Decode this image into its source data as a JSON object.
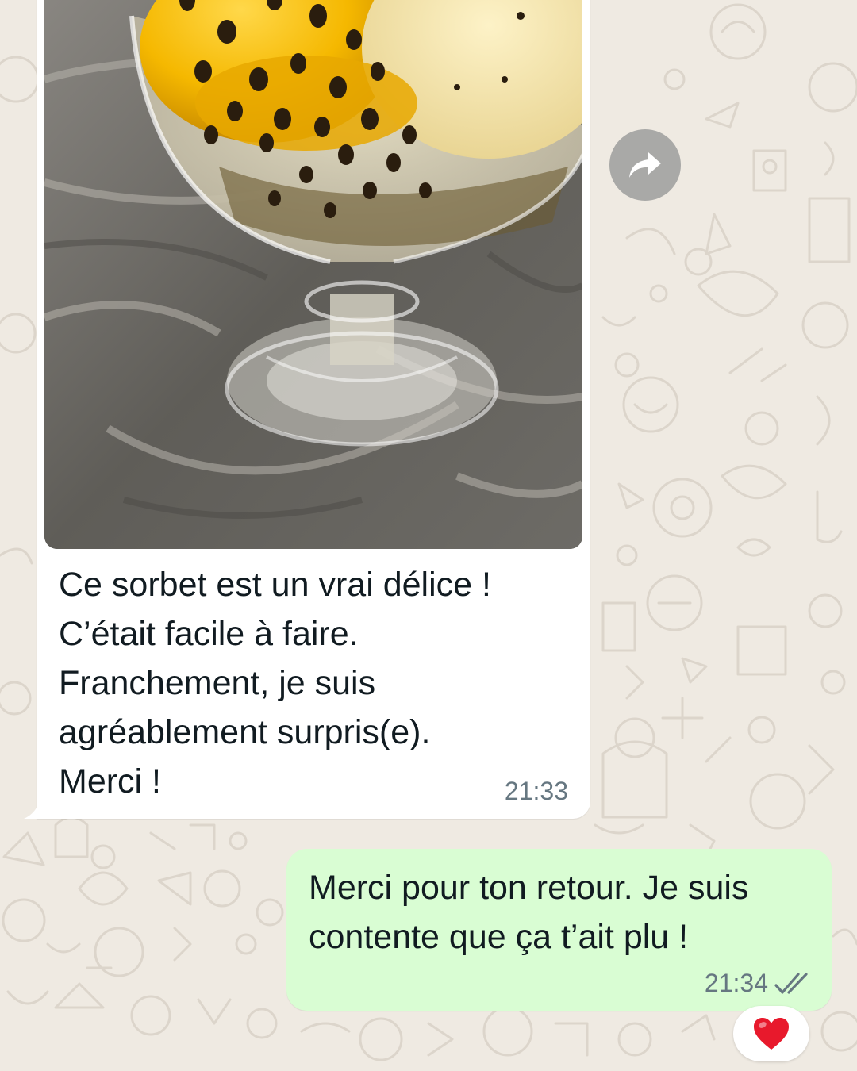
{
  "incoming_message": {
    "attachment": "sorbet-photo",
    "lines": [
      "Ce sorbet est un vrai délice !",
      "C’était facile à faire.",
      "Franchement, je suis",
      "agréablement surpris(e).",
      "Merci !"
    ],
    "time": "21:33"
  },
  "forward": {
    "icon": "forward-arrow-icon"
  },
  "outgoing_message": {
    "lines": [
      "Merci pour ton retour. Je suis",
      "contente que ça t’ait plu !"
    ],
    "time": "21:34",
    "status_icon": "double-check-icon"
  },
  "reaction": {
    "emoji": "❤️",
    "icon": "heart-icon"
  },
  "colors": {
    "chat_background": "#efeae2",
    "incoming_bubble": "#ffffff",
    "outgoing_bubble": "#d9fdd3",
    "timestamp": "#667781",
    "text": "#111b21"
  }
}
